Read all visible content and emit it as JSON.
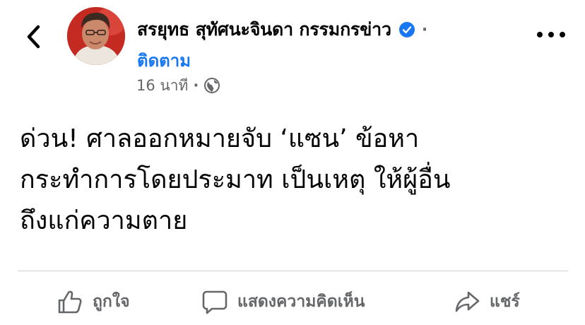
{
  "header": {
    "author_name": "สรยุทธ สุทัศนะจินดา กรรมกรข่าว",
    "separator": "·",
    "follow_label": "ติดตาม",
    "timestamp": "16 นาที",
    "meta_separator": "·",
    "icons": {
      "back": "chevron-left-icon",
      "verified": "verified-badge-icon",
      "audience": "globe-icon",
      "more": "more-options-icon"
    },
    "accent_color": "#1877f2"
  },
  "post": {
    "lines": [
      "ด่วน! ศาลออกหมายจับ ‘แซน’ ข้อหา",
      "กระทำการโดยประมาท เป็นเหตุ ให้ผู้อื่น",
      "ถึงแก่ความตาย"
    ]
  },
  "actions": {
    "like_label": "ถูกใจ",
    "comment_label": "แสดงความคิดเห็น",
    "share_label": "แชร์",
    "icons": {
      "like": "thumbs-up-icon",
      "comment": "comment-bubble-icon",
      "share": "share-arrow-icon"
    }
  }
}
